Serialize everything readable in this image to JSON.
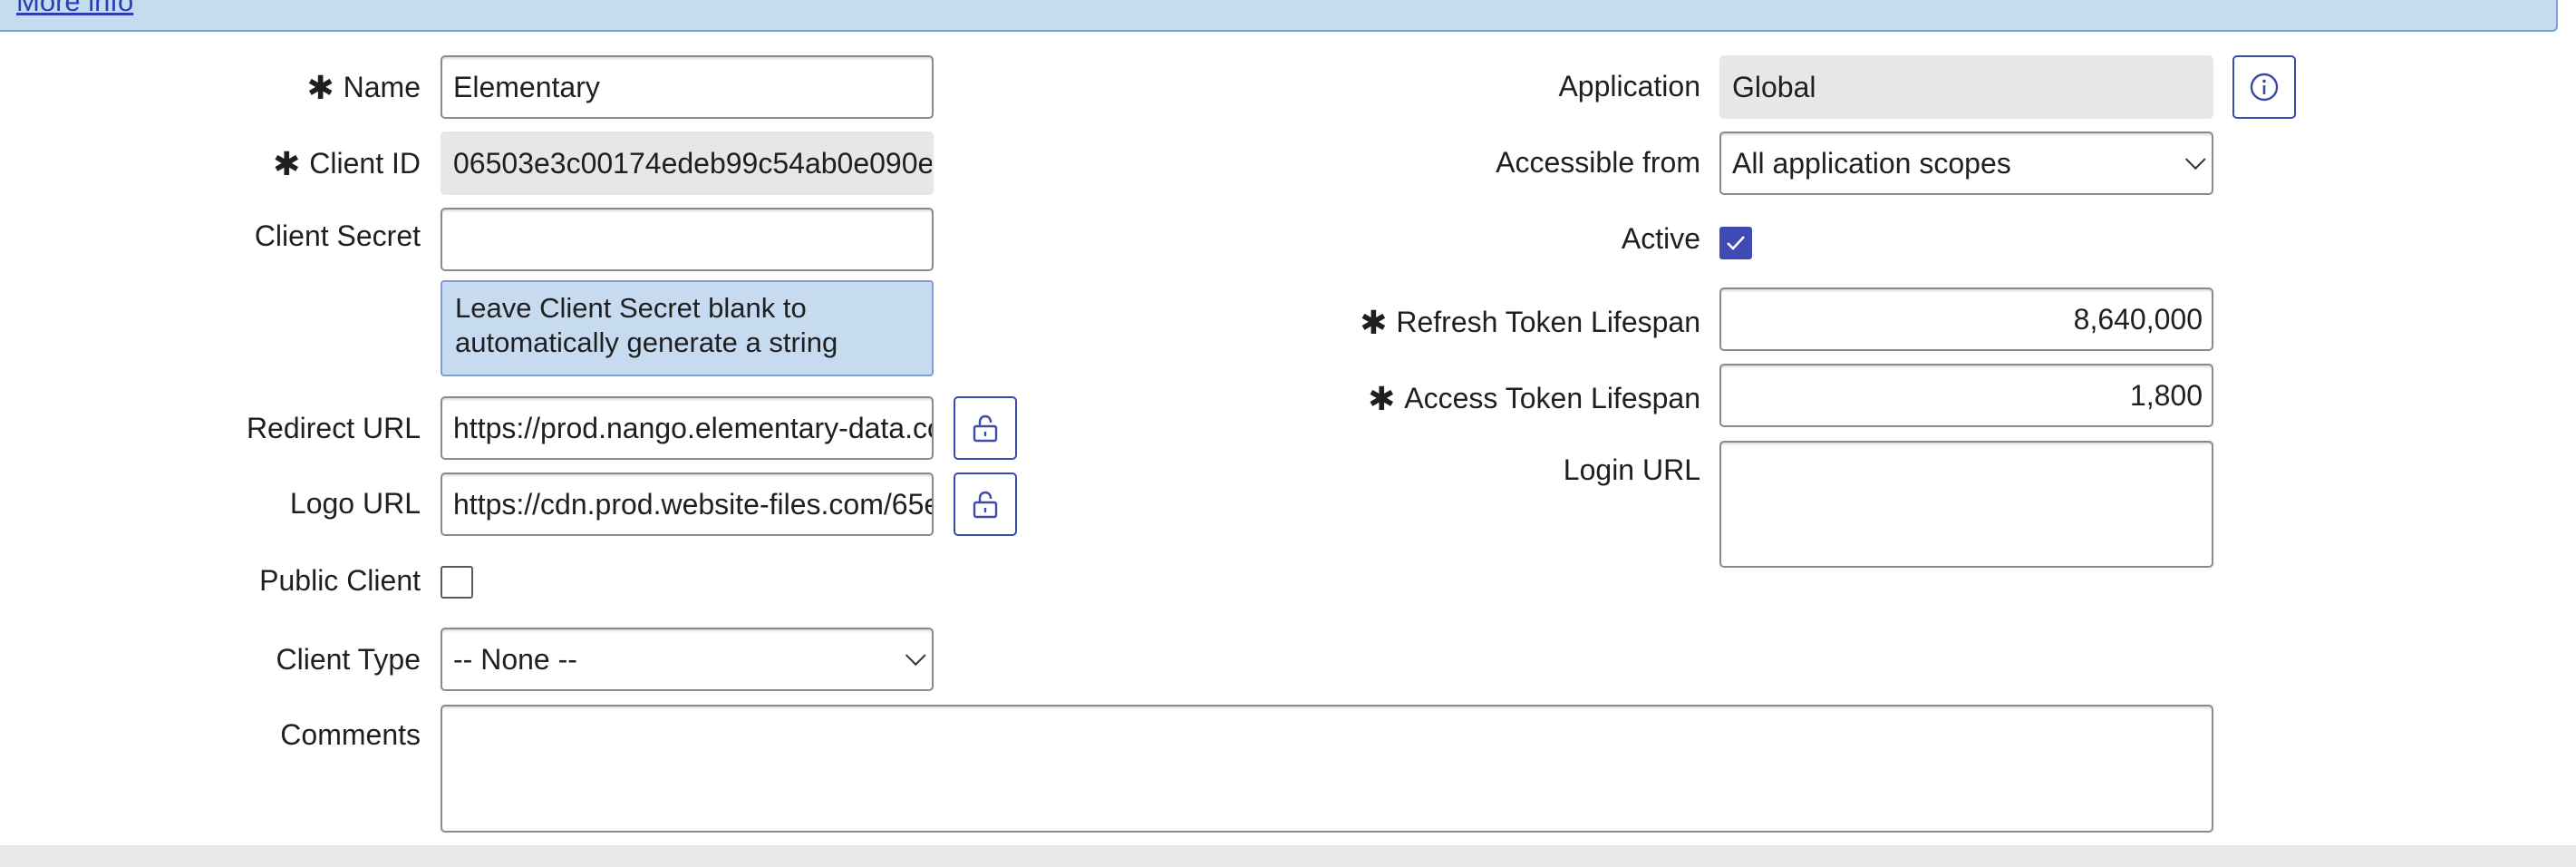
{
  "banner": {
    "link_text": "More info"
  },
  "form": {
    "name": {
      "label": "Name",
      "value": "Elementary"
    },
    "client_id": {
      "label": "Client ID",
      "value": "06503e3c00174edeb99c54ab0e090e"
    },
    "client_secret": {
      "label": "Client Secret",
      "value": "",
      "hint": "Leave Client Secret blank to automatically generate a string"
    },
    "redirect_url": {
      "label": "Redirect URL",
      "value": "https://prod.nango.elementary-data.co"
    },
    "logo_url": {
      "label": "Logo URL",
      "value": "https://cdn.prod.website-files.com/65e"
    },
    "public_client": {
      "label": "Public Client",
      "checked": false
    },
    "client_type": {
      "label": "Client Type",
      "value": "-- None --"
    },
    "comments": {
      "label": "Comments",
      "value": ""
    },
    "application": {
      "label": "Application",
      "value": "Global"
    },
    "accessible_from": {
      "label": "Accessible from",
      "value": "All application scopes"
    },
    "active": {
      "label": "Active",
      "checked": true
    },
    "refresh_token_lifespan": {
      "label": "Refresh Token Lifespan",
      "value": "8,640,000"
    },
    "access_token_lifespan": {
      "label": "Access Token Lifespan",
      "value": "1,800"
    },
    "login_url": {
      "label": "Login URL",
      "value": ""
    }
  },
  "icons": {
    "required": "asterisk-icon",
    "info": "info-icon",
    "unlock": "unlock-icon",
    "check": "checkmark-icon",
    "dropdown": "chevron-down-icon"
  },
  "colors": {
    "accent": "#3f4bb3",
    "banner_bg": "#c6daf0",
    "readonly_bg": "#e6e7e9"
  }
}
